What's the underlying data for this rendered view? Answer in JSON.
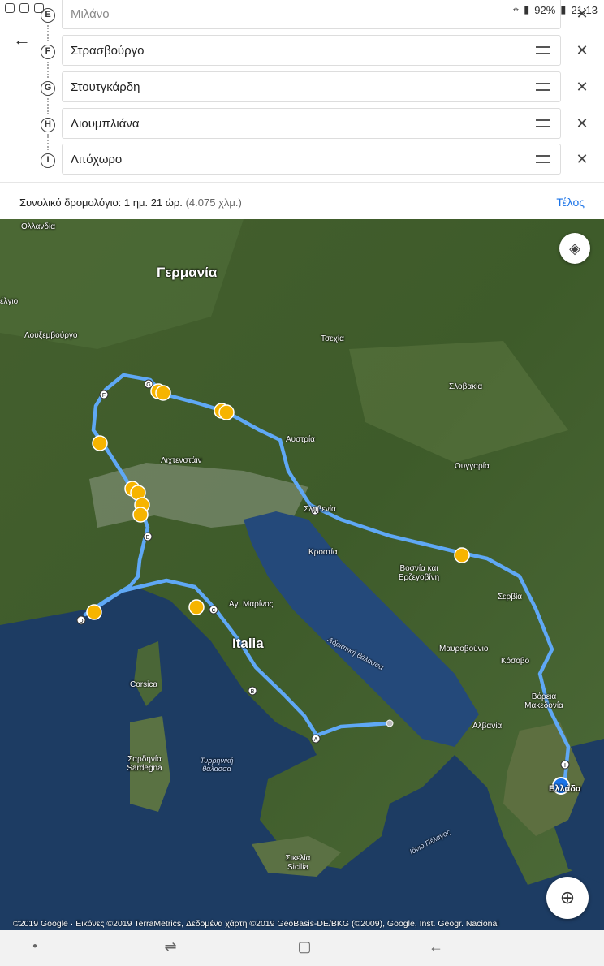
{
  "status": {
    "time": "21:13",
    "battery": "92%"
  },
  "stops": [
    {
      "letter": "E",
      "name": "Μιλάνο"
    },
    {
      "letter": "F",
      "name": "Στρασβούργο"
    },
    {
      "letter": "G",
      "name": "Στουτγκάρδη"
    },
    {
      "letter": "H",
      "name": "Λιουμπλιάνα"
    },
    {
      "letter": "I",
      "name": "Λιτόχωρο"
    }
  ],
  "summary": {
    "label": "Συνολικό δρομολόγιο: 1 ημ. 21 ώρ.",
    "distance": "(4.075 χλμ.)",
    "done": "Τέλος"
  },
  "map": {
    "labels": {
      "netherlands": "Ολλανδία",
      "germany": "Γερμανία",
      "belgium": "έλγιο",
      "luxembourg": "Λουξεμβούργο",
      "czechia": "Τσεχία",
      "slovakia": "Σλοβακία",
      "austria": "Αυστρία",
      "liechtenstein": "Λιχτενστάιν",
      "hungary": "Ουγγαρία",
      "slovenia": "Σλοβενία",
      "croatia": "Κροατία",
      "bosnia": "Βοσνία και Ερζεγοβίνη",
      "serbia": "Σερβία",
      "san_marino": "Αγ. Μαρίνος",
      "italy": "Italia",
      "montenegro": "Μαυροβούνιο",
      "kosovo": "Κόσοβο",
      "adriatic": "Αδριατική θάλασσα",
      "north_macedonia": "Βόρεια Μακεδονία",
      "albania": "Αλβανία",
      "corsica": "Corsica",
      "sardinia": "Σαρδηνία Sardegna",
      "tyrrhenian": "Τυρρηνική θάλασσα",
      "greece": "Ελλάδα",
      "sicily": "Σικελία Sicilia",
      "ionian": "Ιόνιο Πέλαγος"
    },
    "copyright": "©2019 Google · Εικόνες ©2019 TerraMetrics, Δεδομένα χάρτη ©2019 GeoBasis-DE/BKG (©2009), Google, Inst. Geogr. Nacional",
    "colors": {
      "route": "#5fa8f5",
      "incident": "#f6b400",
      "land": "#3c5a2b",
      "sea": "#1d3c63"
    }
  },
  "nav": {
    "recents": "recents-icon",
    "home": "home-icon",
    "back": "back-icon"
  }
}
